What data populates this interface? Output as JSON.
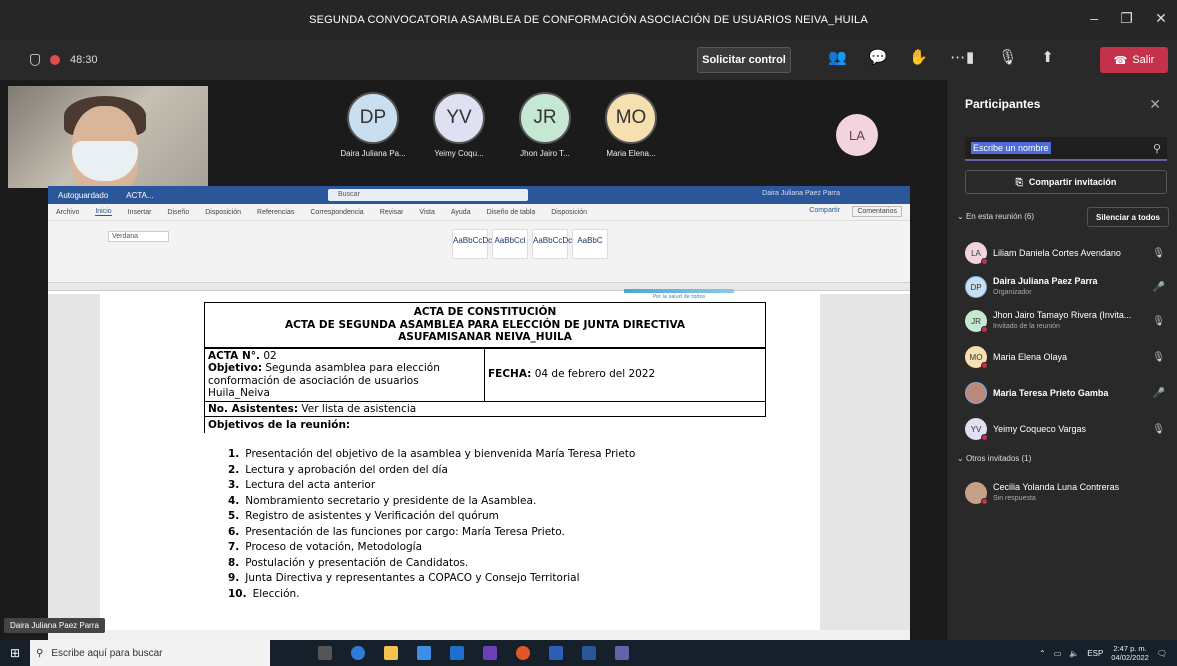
{
  "window": {
    "title": "SEGUNDA CONVOCATORIA ASAMBLEA DE CONFORMACIÓN ASOCIACIÓN DE USUARIOS NEIVA_HUILA"
  },
  "toolbar": {
    "timer": "48:30",
    "control_label": "Solicitar control",
    "exit_label": "Salir"
  },
  "stage": {
    "avatars": [
      {
        "initials": "DP",
        "name": "Daira Juliana Pa...",
        "color": "#c9dff0"
      },
      {
        "initials": "YV",
        "name": "Yeimy Coqu...",
        "color": "#dfe0f2"
      },
      {
        "initials": "JR",
        "name": "Jhon Jairo T...",
        "color": "#c6e8d2"
      },
      {
        "initials": "MO",
        "name": "Maria Elena...",
        "color": "#f6dfb0"
      }
    ],
    "la_initials": "LA",
    "camera_label": "Daira Juliana Paez Parra"
  },
  "word": {
    "autosave": "Autoguardado",
    "filename": "ACTA...",
    "search": "Buscar",
    "user": "Daira Juliana Paez Parra",
    "menu": [
      "Archivo",
      "Inicio",
      "Insertar",
      "Diseño",
      "Disposición",
      "Referencias",
      "Correspondencia",
      "Revisar",
      "Vista",
      "Ayuda",
      "Diseño de tabla",
      "Disposición"
    ],
    "share": "Compartir",
    "comments": "Comentarios",
    "font": "Verdana",
    "styles": [
      "AaBbCcDc",
      "AaBbCcl",
      "AaBbCcDc",
      "AaBbC"
    ],
    "doc": {
      "logo_caption": "Por la salud de todos",
      "header_lines": [
        "ACTA DE CONSTITUCIÓN",
        "ACTA DE SEGUNDA ASAMBLEA PARA ELECCIÓN DE JUNTA DIRECTIVA",
        "ASUFAMISANAR NEIVA_HUILA"
      ],
      "acta_label": "ACTA N°.",
      "acta_number": "02",
      "objetivo_label": "Objetivo:",
      "objetivo_text": "Segunda asamblea para elección conformación de asociación de usuarios Huila_Neiva",
      "fecha_label": "FECHA:",
      "fecha_value": "04 de febrero del 2022",
      "asistentes_label": "No. Asistentes:",
      "asistentes_value": "Ver lista de asistencia",
      "objetivos_title": "Objetivos de la reunión:",
      "items": [
        {
          "n": "1.",
          "t": "Presentación del objetivo de la asamblea y bienvenida María Teresa Prieto"
        },
        {
          "n": "2.",
          "t": "Lectura y aprobación del orden del día"
        },
        {
          "n": "3.",
          "t": "Lectura del acta anterior"
        },
        {
          "n": "4.",
          "t": "Nombramiento secretario y presidente de la Asamblea."
        },
        {
          "n": "5.",
          "t": "Registro de asistentes y Verificación del quórum"
        },
        {
          "n": "6.",
          "t": "Presentación de las funciones por cargo: María Teresa Prieto."
        },
        {
          "n": "7.",
          "t": "Proceso de votación, Metodología"
        },
        {
          "n": "8.",
          "t": "Postulación y presentación de Candidatos."
        },
        {
          "n": "9.",
          "t": "Junta Directiva y representantes a COPACO y Consejo Territorial"
        },
        {
          "n": "10.",
          "t": "Elección."
        }
      ]
    }
  },
  "panel": {
    "title": "Participantes",
    "search_placeholder": "Escribe un nombre",
    "invite_label": "Compartir invitación",
    "in_meeting_label": "En esta reunión (6)",
    "mute_all_label": "Silenciar a todos",
    "participants": [
      {
        "initials": "LA",
        "name": "Liliam Daniela Cortes Avendano",
        "sub": "",
        "color": "#f2d4de"
      },
      {
        "initials": "DP",
        "name": "Daira Juliana Paez Parra",
        "sub": "Organizador",
        "color": "#c9dff0"
      },
      {
        "initials": "JR",
        "name": "Jhon Jairo Tamayo Rivera (Invita...",
        "sub": "Invitado de la reunión",
        "color": "#c6e8d2"
      },
      {
        "initials": "MO",
        "name": "Maria Elena Olaya",
        "sub": "",
        "color": "#f6dfb0"
      },
      {
        "initials": "",
        "name": "Maria Teresa Prieto Gamba",
        "sub": "",
        "color": "#b98a78"
      },
      {
        "initials": "YV",
        "name": "Yeimy Coqueco Vargas",
        "sub": "",
        "color": "#dfe0f2"
      }
    ],
    "others_label": "Otros invitados (1)",
    "other_name": "Cecilia Yolanda Luna Contreras",
    "other_sub": "Sin respuesta"
  },
  "taskbar": {
    "search_placeholder": "Escribe aquí para buscar",
    "lang": "ESP",
    "time": "2:47 p. m.",
    "date": "04/02/2022"
  }
}
